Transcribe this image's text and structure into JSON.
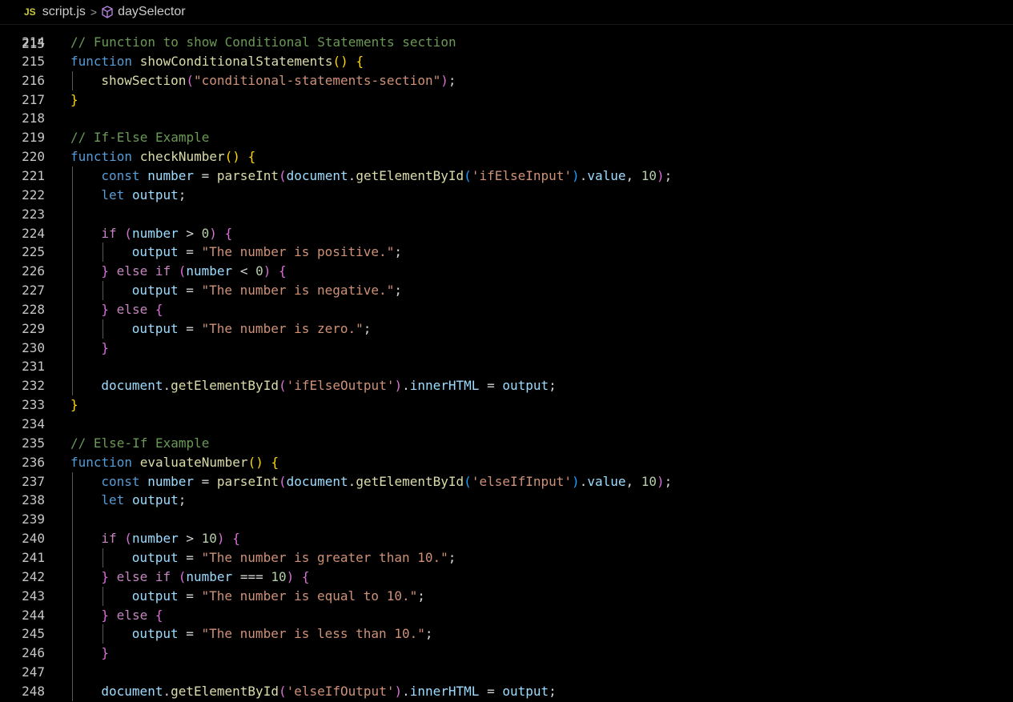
{
  "breadcrumb": {
    "file_icon": "JS",
    "file": "script.js",
    "separator": ">",
    "symbol_icon": "cube-icon",
    "symbol": "daySelector"
  },
  "partial_line": "215",
  "lines": [
    {
      "n": "214",
      "indent": 0,
      "tokens": [
        [
          "c",
          "// Function to show Conditional Statements section"
        ]
      ]
    },
    {
      "n": "215",
      "indent": 0,
      "tokens": [
        [
          "k",
          "function"
        ],
        [
          "p",
          " "
        ],
        [
          "f",
          "showConditionalStatements"
        ],
        [
          "b1",
          "()"
        ],
        [
          "p",
          " "
        ],
        [
          "b1",
          "{"
        ]
      ]
    },
    {
      "n": "216",
      "indent": 1,
      "tokens": [
        [
          "f",
          "showSection"
        ],
        [
          "b2",
          "("
        ],
        [
          "s",
          "\"conditional-statements-section\""
        ],
        [
          "b2",
          ")"
        ],
        [
          "p",
          ";"
        ]
      ]
    },
    {
      "n": "217",
      "indent": 0,
      "tokens": [
        [
          "b1",
          "}"
        ]
      ]
    },
    {
      "n": "218",
      "indent": 0,
      "tokens": []
    },
    {
      "n": "219",
      "indent": 0,
      "tokens": [
        [
          "c",
          "// If-Else Example"
        ]
      ]
    },
    {
      "n": "220",
      "indent": 0,
      "tokens": [
        [
          "k",
          "function"
        ],
        [
          "p",
          " "
        ],
        [
          "f",
          "checkNumber"
        ],
        [
          "b1",
          "()"
        ],
        [
          "p",
          " "
        ],
        [
          "b1",
          "{"
        ]
      ]
    },
    {
      "n": "221",
      "indent": 1,
      "tokens": [
        [
          "k",
          "const"
        ],
        [
          "p",
          " "
        ],
        [
          "v",
          "number"
        ],
        [
          "p",
          " = "
        ],
        [
          "f",
          "parseInt"
        ],
        [
          "b2",
          "("
        ],
        [
          "v",
          "document"
        ],
        [
          "p",
          "."
        ],
        [
          "f",
          "getElementById"
        ],
        [
          "b3",
          "("
        ],
        [
          "s",
          "'ifElseInput'"
        ],
        [
          "b3",
          ")"
        ],
        [
          "p",
          "."
        ],
        [
          "v",
          "value"
        ],
        [
          "p",
          ", "
        ],
        [
          "n",
          "10"
        ],
        [
          "b2",
          ")"
        ],
        [
          "p",
          ";"
        ]
      ]
    },
    {
      "n": "222",
      "indent": 1,
      "tokens": [
        [
          "k",
          "let"
        ],
        [
          "p",
          " "
        ],
        [
          "v",
          "output"
        ],
        [
          "p",
          ";"
        ]
      ]
    },
    {
      "n": "223",
      "indent": 1,
      "tokens": []
    },
    {
      "n": "224",
      "indent": 1,
      "tokens": [
        [
          "kc",
          "if"
        ],
        [
          "p",
          " "
        ],
        [
          "b2",
          "("
        ],
        [
          "v",
          "number"
        ],
        [
          "p",
          " > "
        ],
        [
          "n",
          "0"
        ],
        [
          "b2",
          ")"
        ],
        [
          "p",
          " "
        ],
        [
          "b2",
          "{"
        ]
      ]
    },
    {
      "n": "225",
      "indent": 2,
      "tokens": [
        [
          "v",
          "output"
        ],
        [
          "p",
          " = "
        ],
        [
          "s",
          "\"The number is positive.\""
        ],
        [
          "p",
          ";"
        ]
      ]
    },
    {
      "n": "226",
      "indent": 1,
      "tokens": [
        [
          "b2",
          "}"
        ],
        [
          "p",
          " "
        ],
        [
          "kc",
          "else"
        ],
        [
          "p",
          " "
        ],
        [
          "kc",
          "if"
        ],
        [
          "p",
          " "
        ],
        [
          "b2",
          "("
        ],
        [
          "v",
          "number"
        ],
        [
          "p",
          " < "
        ],
        [
          "n",
          "0"
        ],
        [
          "b2",
          ")"
        ],
        [
          "p",
          " "
        ],
        [
          "b2",
          "{"
        ]
      ]
    },
    {
      "n": "227",
      "indent": 2,
      "tokens": [
        [
          "v",
          "output"
        ],
        [
          "p",
          " = "
        ],
        [
          "s",
          "\"The number is negative.\""
        ],
        [
          "p",
          ";"
        ]
      ]
    },
    {
      "n": "228",
      "indent": 1,
      "tokens": [
        [
          "b2",
          "}"
        ],
        [
          "p",
          " "
        ],
        [
          "kc",
          "else"
        ],
        [
          "p",
          " "
        ],
        [
          "b2",
          "{"
        ]
      ]
    },
    {
      "n": "229",
      "indent": 2,
      "tokens": [
        [
          "v",
          "output"
        ],
        [
          "p",
          " = "
        ],
        [
          "s",
          "\"The number is zero.\""
        ],
        [
          "p",
          ";"
        ]
      ]
    },
    {
      "n": "230",
      "indent": 1,
      "tokens": [
        [
          "b2",
          "}"
        ]
      ]
    },
    {
      "n": "231",
      "indent": 1,
      "tokens": []
    },
    {
      "n": "232",
      "indent": 1,
      "tokens": [
        [
          "v",
          "document"
        ],
        [
          "p",
          "."
        ],
        [
          "f",
          "getElementById"
        ],
        [
          "b2",
          "("
        ],
        [
          "s",
          "'ifElseOutput'"
        ],
        [
          "b2",
          ")"
        ],
        [
          "p",
          "."
        ],
        [
          "v",
          "innerHTML"
        ],
        [
          "p",
          " = "
        ],
        [
          "v",
          "output"
        ],
        [
          "p",
          ";"
        ]
      ]
    },
    {
      "n": "233",
      "indent": 0,
      "tokens": [
        [
          "b1",
          "}"
        ]
      ]
    },
    {
      "n": "234",
      "indent": 0,
      "tokens": []
    },
    {
      "n": "235",
      "indent": 0,
      "tokens": [
        [
          "c",
          "// Else-If Example"
        ]
      ]
    },
    {
      "n": "236",
      "indent": 0,
      "tokens": [
        [
          "k",
          "function"
        ],
        [
          "p",
          " "
        ],
        [
          "f",
          "evaluateNumber"
        ],
        [
          "b1",
          "()"
        ],
        [
          "p",
          " "
        ],
        [
          "b1",
          "{"
        ]
      ]
    },
    {
      "n": "237",
      "indent": 1,
      "tokens": [
        [
          "k",
          "const"
        ],
        [
          "p",
          " "
        ],
        [
          "v",
          "number"
        ],
        [
          "p",
          " = "
        ],
        [
          "f",
          "parseInt"
        ],
        [
          "b2",
          "("
        ],
        [
          "v",
          "document"
        ],
        [
          "p",
          "."
        ],
        [
          "f",
          "getElementById"
        ],
        [
          "b3",
          "("
        ],
        [
          "s",
          "'elseIfInput'"
        ],
        [
          "b3",
          ")"
        ],
        [
          "p",
          "."
        ],
        [
          "v",
          "value"
        ],
        [
          "p",
          ", "
        ],
        [
          "n",
          "10"
        ],
        [
          "b2",
          ")"
        ],
        [
          "p",
          ";"
        ]
      ]
    },
    {
      "n": "238",
      "indent": 1,
      "tokens": [
        [
          "k",
          "let"
        ],
        [
          "p",
          " "
        ],
        [
          "v",
          "output"
        ],
        [
          "p",
          ";"
        ]
      ]
    },
    {
      "n": "239",
      "indent": 1,
      "tokens": []
    },
    {
      "n": "240",
      "indent": 1,
      "tokens": [
        [
          "kc",
          "if"
        ],
        [
          "p",
          " "
        ],
        [
          "b2",
          "("
        ],
        [
          "v",
          "number"
        ],
        [
          "p",
          " > "
        ],
        [
          "n",
          "10"
        ],
        [
          "b2",
          ")"
        ],
        [
          "p",
          " "
        ],
        [
          "b2",
          "{"
        ]
      ]
    },
    {
      "n": "241",
      "indent": 2,
      "tokens": [
        [
          "v",
          "output"
        ],
        [
          "p",
          " = "
        ],
        [
          "s",
          "\"The number is greater than 10.\""
        ],
        [
          "p",
          ";"
        ]
      ]
    },
    {
      "n": "242",
      "indent": 1,
      "tokens": [
        [
          "b2",
          "}"
        ],
        [
          "p",
          " "
        ],
        [
          "kc",
          "else"
        ],
        [
          "p",
          " "
        ],
        [
          "kc",
          "if"
        ],
        [
          "p",
          " "
        ],
        [
          "b2",
          "("
        ],
        [
          "v",
          "number"
        ],
        [
          "p",
          " === "
        ],
        [
          "n",
          "10"
        ],
        [
          "b2",
          ")"
        ],
        [
          "p",
          " "
        ],
        [
          "b2",
          "{"
        ]
      ]
    },
    {
      "n": "243",
      "indent": 2,
      "tokens": [
        [
          "v",
          "output"
        ],
        [
          "p",
          " = "
        ],
        [
          "s",
          "\"The number is equal to 10.\""
        ],
        [
          "p",
          ";"
        ]
      ]
    },
    {
      "n": "244",
      "indent": 1,
      "tokens": [
        [
          "b2",
          "}"
        ],
        [
          "p",
          " "
        ],
        [
          "kc",
          "else"
        ],
        [
          "p",
          " "
        ],
        [
          "b2",
          "{"
        ]
      ]
    },
    {
      "n": "245",
      "indent": 2,
      "tokens": [
        [
          "v",
          "output"
        ],
        [
          "p",
          " = "
        ],
        [
          "s",
          "\"The number is less than 10.\""
        ],
        [
          "p",
          ";"
        ]
      ]
    },
    {
      "n": "246",
      "indent": 1,
      "tokens": [
        [
          "b2",
          "}"
        ]
      ]
    },
    {
      "n": "247",
      "indent": 1,
      "tokens": []
    },
    {
      "n": "248",
      "indent": 1,
      "tokens": [
        [
          "v",
          "document"
        ],
        [
          "p",
          "."
        ],
        [
          "f",
          "getElementById"
        ],
        [
          "b2",
          "("
        ],
        [
          "s",
          "'elseIfOutput'"
        ],
        [
          "b2",
          ")"
        ],
        [
          "p",
          "."
        ],
        [
          "v",
          "innerHTML"
        ],
        [
          "p",
          " = "
        ],
        [
          "v",
          "output"
        ],
        [
          "p",
          ";"
        ]
      ]
    }
  ]
}
